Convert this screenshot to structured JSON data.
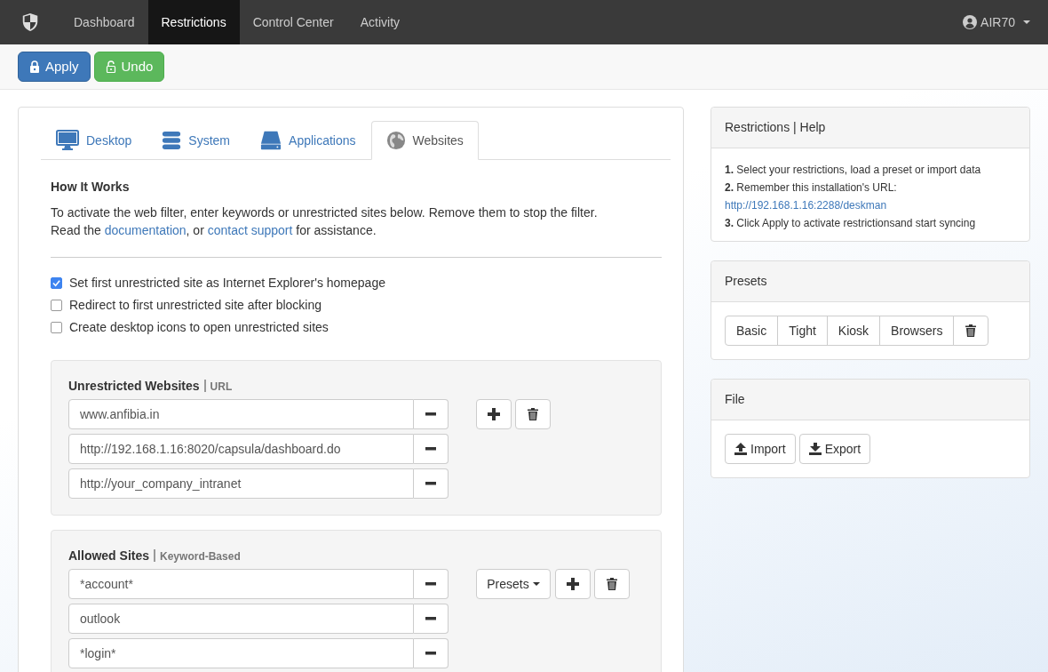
{
  "navbar": {
    "items": [
      {
        "label": "Dashboard",
        "selected": false
      },
      {
        "label": "Restrictions",
        "selected": true
      },
      {
        "label": "Control Center",
        "selected": false
      },
      {
        "label": "Activity",
        "selected": false
      }
    ],
    "user": "AIR70"
  },
  "toolbar": [
    {
      "kind": "apply",
      "label": "Apply"
    },
    {
      "kind": "undo",
      "label": "Undo"
    }
  ],
  "tabs": [
    {
      "label": "Desktop",
      "kind": "monitor",
      "selected": false
    },
    {
      "label": "System",
      "kind": "server",
      "selected": false
    },
    {
      "label": "Applications",
      "kind": "drive",
      "selected": false
    },
    {
      "label": "Websites",
      "kind": "globe",
      "selected": true
    }
  ],
  "how_it_works": {
    "title": "How It Works",
    "line1": "To activate the web filter, enter keywords or unrestricted sites below. Remove them to stop the filter.",
    "line2": [
      {
        "kind": "text",
        "text": "Read the "
      },
      {
        "kind": "link",
        "text": "documentation"
      },
      {
        "kind": "text",
        "text": ", or "
      },
      {
        "kind": "link",
        "text": "contact support"
      },
      {
        "kind": "text",
        "text": " for assistance."
      }
    ]
  },
  "options": [
    {
      "label": "Set first unrestricted site as Internet Explorer's homepage",
      "checked": true
    },
    {
      "label": "Redirect to first unrestricted site after blocking",
      "checked": false
    },
    {
      "label": "Create desktop icons to open unrestricted sites",
      "checked": false
    }
  ],
  "sections": [
    {
      "title": "Unrestricted Websites",
      "subtitle": "URL",
      "entries": [
        "www.anfibia.in",
        "http://192.168.1.16:8020/capsula/dashboard.do",
        "http://your_company_intranet"
      ],
      "actions": [
        {
          "kind": "add"
        },
        {
          "kind": "delete"
        }
      ]
    },
    {
      "title": "Allowed Sites",
      "subtitle": "Keyword-Based",
      "entries": [
        "*account*",
        "outlook",
        "*login*"
      ],
      "actions": [
        {
          "kind": "presets",
          "label": "Presets"
        },
        {
          "kind": "add"
        },
        {
          "kind": "delete"
        }
      ]
    }
  ],
  "help": {
    "title": "Restrictions | Help",
    "steps": [
      {
        "text": "**1.** Select your restrictions, load a preset or import data"
      },
      {
        "text": "**2.** Remember this installation's URL:",
        "link": "http://192.168.1.16:2288/deskman"
      },
      {
        "text": "**3.** Click Apply to activate restrictionsand start syncing"
      }
    ]
  },
  "presets": {
    "title": "Presets",
    "items": [
      "Basic",
      "Tight",
      "Kiosk",
      "Browsers"
    ]
  },
  "file": {
    "title": "File",
    "buttons": [
      {
        "kind": "import",
        "label": "Import"
      },
      {
        "kind": "export",
        "label": "Export"
      }
    ]
  }
}
